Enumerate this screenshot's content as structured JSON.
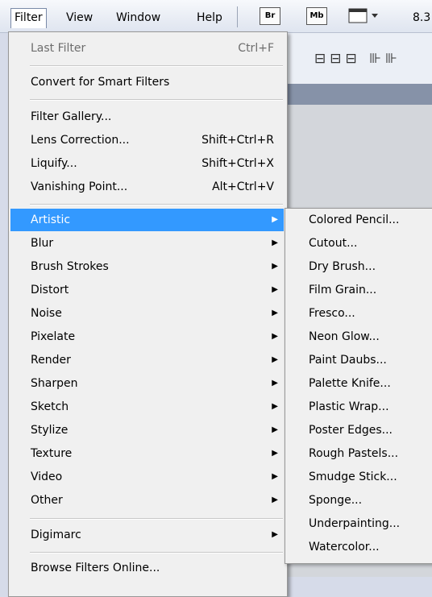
{
  "menubar": {
    "items": [
      "Filter",
      "View",
      "Window",
      "Help"
    ],
    "br": "Br",
    "mb": "Mb",
    "zoom": "8.3"
  },
  "filter_menu": {
    "last_filter": {
      "label": "Last Filter",
      "shortcut": "Ctrl+F"
    },
    "convert": "Convert for Smart Filters",
    "gallery": "Filter Gallery...",
    "lens": {
      "label": "Lens Correction...",
      "shortcut": "Shift+Ctrl+R"
    },
    "liquify": {
      "label": "Liquify...",
      "shortcut": "Shift+Ctrl+X"
    },
    "vanishing": {
      "label": "Vanishing Point...",
      "shortcut": "Alt+Ctrl+V"
    },
    "submenus": [
      "Artistic",
      "Blur",
      "Brush Strokes",
      "Distort",
      "Noise",
      "Pixelate",
      "Render",
      "Sharpen",
      "Sketch",
      "Stylize",
      "Texture",
      "Video",
      "Other"
    ],
    "digimarc": "Digimarc",
    "browse": "Browse Filters Online..."
  },
  "artistic_submenu": [
    "Colored Pencil...",
    "Cutout...",
    "Dry Brush...",
    "Film Grain...",
    "Fresco...",
    "Neon Glow...",
    "Paint Daubs...",
    "Palette Knife...",
    "Plastic Wrap...",
    "Poster Edges...",
    "Rough Pastels...",
    "Smudge Stick...",
    "Sponge...",
    "Underpainting...",
    "Watercolor..."
  ],
  "colors": {
    "highlight": "#3399ff",
    "menu_bg": "#f0f0f0"
  }
}
